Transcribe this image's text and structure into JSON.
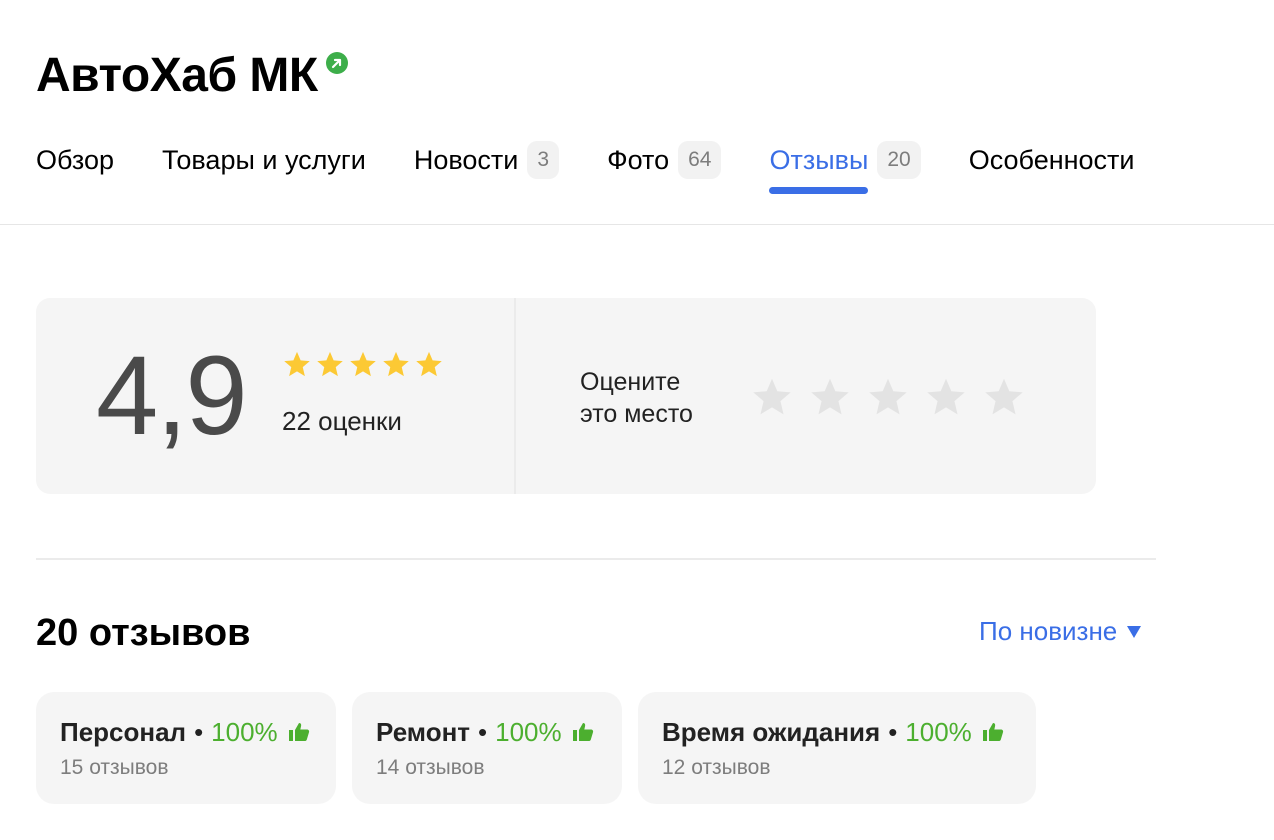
{
  "header": {
    "title": "АвтоХаб МК",
    "verified_color": "#3dae4a",
    "verified_icon": "verified-arrow-icon"
  },
  "tabs": [
    {
      "label": "Обзор",
      "badge": null,
      "active": false
    },
    {
      "label": "Товары и услуги",
      "badge": null,
      "active": false
    },
    {
      "label": "Новости",
      "badge": "3",
      "active": false
    },
    {
      "label": "Фото",
      "badge": "64",
      "active": false
    },
    {
      "label": "Отзывы",
      "badge": "20",
      "active": true
    },
    {
      "label": "Особенности",
      "badge": null,
      "active": false
    }
  ],
  "rating": {
    "value": "4,9",
    "stars_filled": 5,
    "star_color": "#fcc934",
    "count_label": "22 оценки",
    "rate_prompt_line1": "Оцените",
    "rate_prompt_line2": "это место",
    "empty_stars": 5
  },
  "reviews": {
    "title": "20 отзывов",
    "sort_label": "По новизне",
    "accent": "#3a6ee6"
  },
  "aspects": [
    {
      "name": "Персонал",
      "percent": "100%",
      "count": "15 отзывов"
    },
    {
      "name": "Ремонт",
      "percent": "100%",
      "count": "14 отзывов"
    },
    {
      "name": "Время ожидания",
      "percent": "100%",
      "count": "12 отзывов"
    }
  ]
}
